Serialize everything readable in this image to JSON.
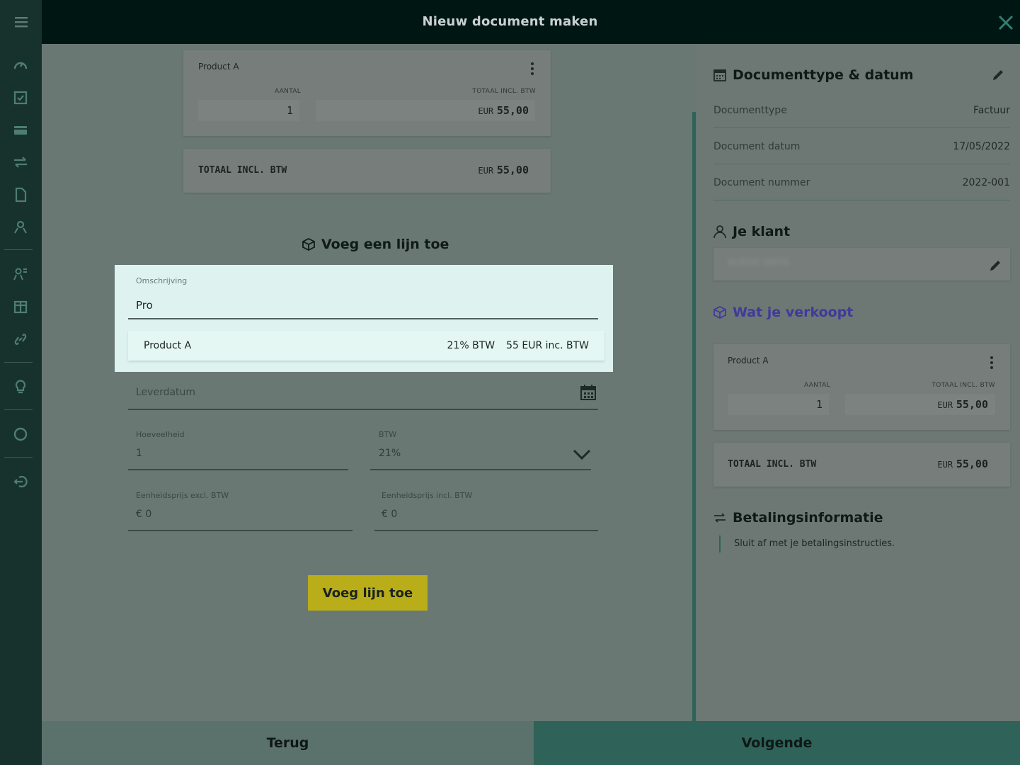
{
  "header": {
    "title": "Nieuw document maken"
  },
  "icons": {
    "menu": "hamburger-icon",
    "close": "close-icon",
    "nav": [
      "dashboard-icon",
      "checklist-icon",
      "card-icon",
      "transfer-icon",
      "document-icon",
      "contacts-icon",
      "person-list-icon",
      "box-icon",
      "link-icon",
      "bulb-icon",
      "circle-icon",
      "logout-icon"
    ]
  },
  "invoice_preview": {
    "line": {
      "name": "Product A",
      "qty_label": "AANTAL",
      "qty": "1",
      "total_label": "TOTAAL INCL. BTW",
      "currency": "EUR",
      "total": "55,00"
    },
    "total": {
      "label": "TOTAAL INCL. BTW",
      "currency": "EUR",
      "value": "55,00"
    }
  },
  "add_line": {
    "heading": "Voeg een lijn toe",
    "description_label": "Omschrijving",
    "description_value": "Pro",
    "suggestion": {
      "name": "Product A",
      "vat": "21% BTW",
      "price": "55 EUR inc. BTW"
    },
    "delivery_date_placeholder": "Leverdatum",
    "quantity_label": "Hoeveelheid",
    "quantity_value": "1",
    "vat_label": "BTW",
    "vat_value": "21%",
    "unit_excl_label": "Eenheidsprijs excl. BTW",
    "unit_excl_value": "€ 0",
    "unit_incl_label": "Eenheidsprijs incl. BTW",
    "unit_incl_value": "€ 0",
    "button": "Voeg lijn toe"
  },
  "summary": {
    "doc_section": "Documenttype & datum",
    "rows": [
      {
        "label": "Documenttype",
        "value": "Factuur"
      },
      {
        "label": "Document datum",
        "value": "17/05/2022"
      },
      {
        "label": "Document nummer",
        "value": "2022-001"
      }
    ],
    "client_section": "Je klant",
    "client_name": "BURDE 0WTS",
    "sell_section": "Wat je verkoopt",
    "line": {
      "name": "Product A",
      "qty_label": "AANTAL",
      "qty": "1",
      "total_label": "TOTAAL INCL. BTW",
      "currency": "EUR",
      "total": "55,00"
    },
    "total": {
      "label": "TOTAAL INCL. BTW",
      "currency": "EUR",
      "value": "55,00"
    },
    "payment_section": "Betalingsinformatie",
    "payment_text": "Sluit af met je betalingsinstructies."
  },
  "footer": {
    "back": "Terug",
    "next": "Volgende"
  },
  "colors": {
    "accent_button": "#b9ad1a",
    "sell_heading": "#3f3a9c",
    "footer_next": "#2f6259",
    "footer_back": "#5b716c"
  }
}
